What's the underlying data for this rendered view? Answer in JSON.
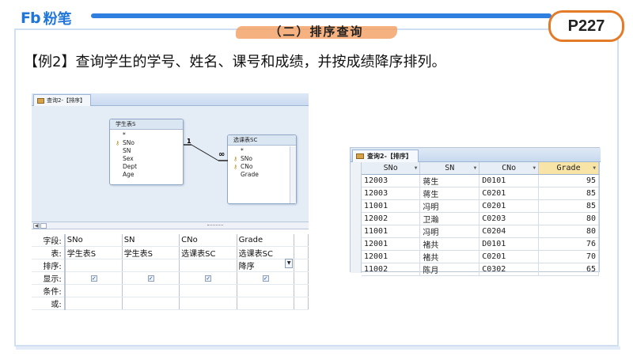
{
  "header": {
    "logo_mark": "Fb",
    "logo_text": "粉笔",
    "section_title": "（二）排序查询",
    "page_label": "P227"
  },
  "question": "【例2】查询学生的学号、姓名、课号和成绩，并按成绩降序排列。",
  "query_design": {
    "tab_label": "查询2-【排序】",
    "tables": [
      {
        "title": "学生表S",
        "fields": [
          "*",
          "SNo",
          "SN",
          "Sex",
          "Dept",
          "Age"
        ],
        "key_fields": [
          "SNo"
        ]
      },
      {
        "title": "选课表SC",
        "fields": [
          "*",
          "SNo",
          "CNo",
          "Grade"
        ],
        "key_fields": [
          "SNo",
          "CNo"
        ]
      }
    ],
    "relation": {
      "one_side": "1",
      "many_side": "∞"
    },
    "grid": {
      "row_labels": [
        "字段:",
        "表:",
        "排序:",
        "显示:",
        "条件:",
        "或:"
      ],
      "columns": [
        {
          "field": "SNo",
          "table": "学生表S",
          "sort": "",
          "show": true
        },
        {
          "field": "SN",
          "table": "学生表S",
          "sort": "",
          "show": true
        },
        {
          "field": "CNo",
          "table": "选课表SC",
          "sort": "",
          "show": true
        },
        {
          "field": "Grade",
          "table": "选课表SC",
          "sort": "降序",
          "show": true
        }
      ]
    }
  },
  "datasheet": {
    "tab_label": "查询2-【排序】",
    "headers": [
      "SNo",
      "SN",
      "CNo",
      "Grade"
    ],
    "highlight_header": "Grade",
    "rows": [
      [
        "12003",
        "蒋生",
        "D0101",
        "95"
      ],
      [
        "12003",
        "蒋生",
        "C0201",
        "85"
      ],
      [
        "11001",
        "冯明",
        "C0201",
        "85"
      ],
      [
        "12002",
        "卫瀚",
        "C0203",
        "80"
      ],
      [
        "11001",
        "冯明",
        "C0204",
        "80"
      ],
      [
        "12001",
        "褚共",
        "D0101",
        "76"
      ],
      [
        "12001",
        "褚共",
        "C0201",
        "70"
      ],
      [
        "11002",
        "陈月",
        "C0302",
        "65"
      ]
    ]
  },
  "colors": {
    "brand_blue": "#1f76d8",
    "title_brush": "#f4a36a",
    "badge_border": "#e47b28",
    "header_highlight": "#f7e4a6"
  }
}
